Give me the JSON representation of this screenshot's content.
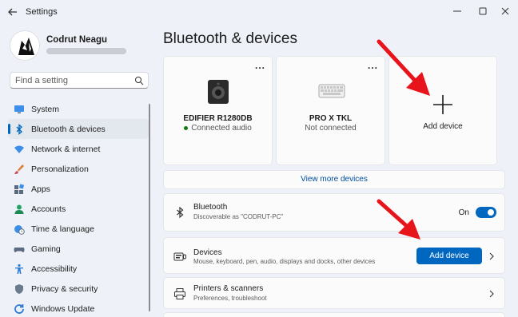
{
  "window": {
    "title": "Settings"
  },
  "user": {
    "name": "Codrut Neagu"
  },
  "search": {
    "placeholder": "Find a setting"
  },
  "sidebar": {
    "items": [
      {
        "label": "System",
        "icon": "monitor-icon"
      },
      {
        "label": "Bluetooth & devices",
        "icon": "bluetooth-icon",
        "active": true
      },
      {
        "label": "Network & internet",
        "icon": "wifi-icon"
      },
      {
        "label": "Personalization",
        "icon": "brush-icon"
      },
      {
        "label": "Apps",
        "icon": "apps-icon"
      },
      {
        "label": "Accounts",
        "icon": "person-icon"
      },
      {
        "label": "Time & language",
        "icon": "globe-clock-icon"
      },
      {
        "label": "Gaming",
        "icon": "gamepad-icon"
      },
      {
        "label": "Accessibility",
        "icon": "accessibility-icon"
      },
      {
        "label": "Privacy & security",
        "icon": "shield-icon"
      },
      {
        "label": "Windows Update",
        "icon": "update-icon"
      }
    ]
  },
  "main": {
    "title": "Bluetooth & devices",
    "tiles": [
      {
        "name": "EDIFIER R1280DB",
        "status": "Connected audio",
        "icon": "speaker-icon"
      },
      {
        "name": "PRO X TKL",
        "status": "Not connected",
        "icon": "keyboard-icon"
      }
    ],
    "add_tile_label": "Add device",
    "more_label": "...",
    "view_more": "View more devices",
    "bluetooth": {
      "title": "Bluetooth",
      "subtitle": "Discoverable as \"CODRUT-PC\"",
      "state": "On"
    },
    "devices": {
      "title": "Devices",
      "subtitle": "Mouse, keyboard, pen, audio, displays and docks, other devices",
      "button": "Add device"
    },
    "printers": {
      "title": "Printers & scanners",
      "subtitle": "Preferences, troubleshoot"
    }
  },
  "colors": {
    "accent": "#0067c0",
    "arrow": "#e8141b",
    "connected": "#0f7b0f"
  }
}
